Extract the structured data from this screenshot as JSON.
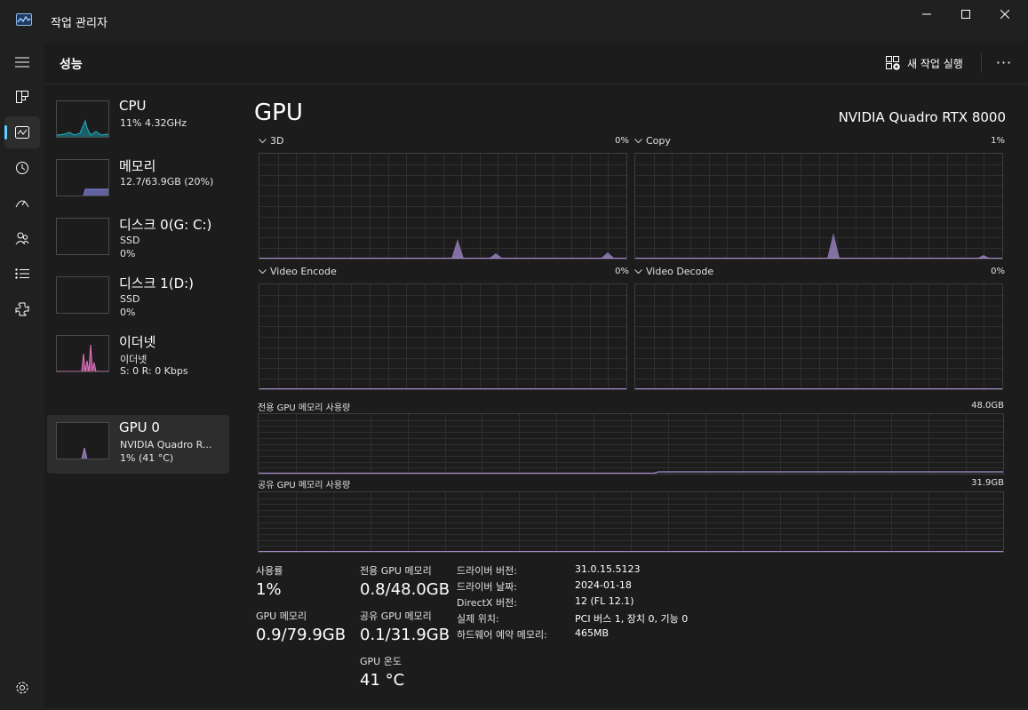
{
  "window": {
    "title": "작업 관리자"
  },
  "header": {
    "page_title": "성능",
    "run_task_label": "새 작업 실행",
    "more_label": "···"
  },
  "devices": [
    {
      "name": "CPU",
      "sub1": "11% 4.32GHz",
      "sub2": ""
    },
    {
      "name": "메모리",
      "sub1": "12.7/63.9GB (20%)",
      "sub2": ""
    },
    {
      "name": "디스크 0(G: C:)",
      "sub1": "SSD",
      "sub2": "0%"
    },
    {
      "name": "디스크 1(D:)",
      "sub1": "SSD",
      "sub2": "0%"
    },
    {
      "name": "이더넷",
      "sub1": "이더넷",
      "sub2": "S: 0 R: 0 Kbps"
    },
    {
      "name": "GPU 0",
      "sub1": "NVIDIA Quadro R...",
      "sub2": "1% (41 °C)"
    }
  ],
  "main": {
    "title": "GPU",
    "model": "NVIDIA Quadro RTX 8000",
    "engines": [
      {
        "label": "3D",
        "value": "0%"
      },
      {
        "label": "Copy",
        "value": "1%"
      },
      {
        "label": "Video Encode",
        "value": "0%"
      },
      {
        "label": "Video Decode",
        "value": "0%"
      }
    ],
    "dedicated_graph": {
      "label": "전용 GPU 메모리 사용량",
      "max": "48.0GB"
    },
    "shared_graph": {
      "label": "공유 GPU 메모리 사용량",
      "max": "31.9GB"
    }
  },
  "stats": {
    "usage_label": "사용률",
    "usage_value": "1%",
    "gpu_mem_label": "GPU 메모리",
    "gpu_mem_value": "0.9/79.9GB",
    "dedicated_label": "전용 GPU 메모리",
    "dedicated_value": "0.8/48.0GB",
    "shared_label": "공유 GPU 메모리",
    "shared_value": "0.1/31.9GB",
    "temp_label": "GPU 온도",
    "temp_value": "41 °C"
  },
  "info": [
    {
      "key": "드라이버 버전:",
      "value": "31.0.15.5123"
    },
    {
      "key": "드라이버 날짜:",
      "value": "2024-01-18"
    },
    {
      "key": "DirectX 버전:",
      "value": "12 (FL 12.1)"
    },
    {
      "key": "실제 위치:",
      "value": "PCI 버스 1, 장치 0, 기능 0"
    },
    {
      "key": "하드웨어 예약 메모리:",
      "value": "465MB"
    }
  ],
  "colors": {
    "gpu_line": "#a78bcf",
    "cpu_line": "#1fb2c7",
    "mem_line": "#8388e3",
    "eth_line": "#e573bf",
    "grid": "#2e2e2e",
    "border": "#3d3d3d"
  },
  "icons": [
    "hamburger-icon",
    "processes-icon",
    "performance-icon",
    "app-history-icon",
    "startup-icon",
    "users-icon",
    "details-icon",
    "services-icon",
    "settings-icon"
  ]
}
